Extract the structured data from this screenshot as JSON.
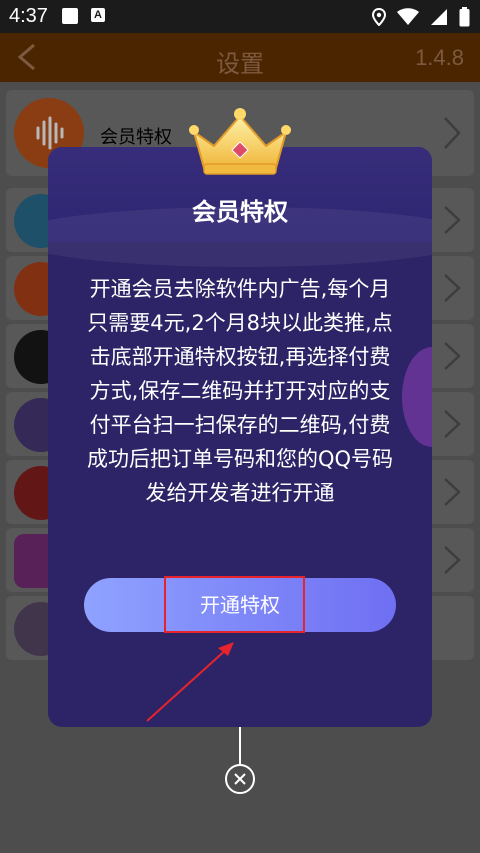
{
  "status_bar": {
    "time": "4:37",
    "notification_icon": "A"
  },
  "app_bar": {
    "title": "设置",
    "version": "1.4.8"
  },
  "list": {
    "items": [
      {
        "label": "会员特权",
        "icon": "sound-wave-icon",
        "color": "#c0541a"
      },
      {
        "label": "",
        "icon": "download-icon",
        "color": "#2a6f93"
      },
      {
        "label": "",
        "icon": "phone-icon",
        "color": "#b5431a"
      },
      {
        "label": "",
        "icon": "camera-icon",
        "color": "#1a1a1a"
      },
      {
        "label": "",
        "icon": "share-icon",
        "color": "#4a3a7a"
      },
      {
        "label": "",
        "icon": "shield-icon",
        "color": "#8a1f1f"
      },
      {
        "label": "",
        "icon": "music-icon",
        "color": "#7a2f7a"
      },
      {
        "label": "",
        "icon": "chat-icon",
        "color": "#5a4a6a"
      }
    ]
  },
  "dialog": {
    "title": "会员特权",
    "body": "开通会员去除软件内广告,每个月只需要4元,2个月8块以此类推,点击底部开通特权按钮,再选择付费方式,保存二维码并打开对应的支付平台扫一扫保存的二维码,付费成功后把订单号码和您的QQ号码发给开发者进行开通",
    "button_label": "开通特权",
    "icon": "crown-icon",
    "close_icon": "close-icon"
  },
  "colors": {
    "app_bar": "#4b2500",
    "dialog_bg": "#2c2466",
    "button_gradient_start": "#8fa2ff",
    "button_gradient_end": "#6f6ff2",
    "highlight": "#e8232b"
  }
}
